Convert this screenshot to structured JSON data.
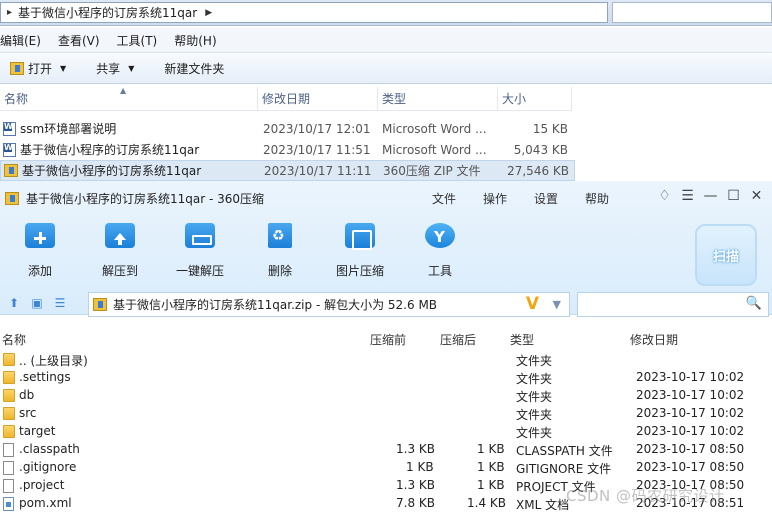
{
  "explorer": {
    "breadcrumb": "基于微信小程序的订房系统11qar",
    "menu": [
      "编辑(E)",
      "查看(V)",
      "工具(T)",
      "帮助(H)"
    ],
    "toolbar": {
      "open": "打开",
      "share": "共享",
      "new_folder": "新建文件夹"
    },
    "columns": {
      "name": "名称",
      "date": "修改日期",
      "type": "类型",
      "size": "大小"
    },
    "files": [
      {
        "name": "ssm环境部署说明",
        "date": "2023/10/17 12:01",
        "type": "Microsoft Word ...",
        "size": "15 KB",
        "icon": "word-doc-icon"
      },
      {
        "name": "基于微信小程序的订房系统11qar",
        "date": "2023/10/17 11:51",
        "type": "Microsoft Word ...",
        "size": "5,043 KB",
        "icon": "word-doc-icon"
      },
      {
        "name": "基于微信小程序的订房系统11qar",
        "date": "2023/10/17 11:11",
        "type": "360压缩 ZIP 文件",
        "size": "27,546 KB",
        "icon": "zip-icon"
      }
    ]
  },
  "zip": {
    "title": "基于微信小程序的订房系统11qar - 360压缩",
    "menu": [
      "文件",
      "操作",
      "设置",
      "帮助"
    ],
    "tools": [
      "添加",
      "解压到",
      "一键解压",
      "删除",
      "图片压缩",
      "工具"
    ],
    "scan_label": "扫描",
    "path": "基于微信小程序的订房系统11qar.zip - 解包大小为 52.6 MB",
    "columns": {
      "name": "名称",
      "compressed": "压缩前",
      "after": "压缩后",
      "type": "类型",
      "date": "修改日期"
    },
    "rows": [
      {
        "name": ".. (上级目录)",
        "before": "",
        "after": "",
        "type": "文件夹",
        "date": "",
        "icon": "folder-icon"
      },
      {
        "name": ".settings",
        "before": "",
        "after": "",
        "type": "文件夹",
        "date": "2023-10-17 10:02",
        "icon": "folder-icon"
      },
      {
        "name": "db",
        "before": "",
        "after": "",
        "type": "文件夹",
        "date": "2023-10-17 10:02",
        "icon": "folder-icon"
      },
      {
        "name": "src",
        "before": "",
        "after": "",
        "type": "文件夹",
        "date": "2023-10-17 10:02",
        "icon": "folder-icon"
      },
      {
        "name": "target",
        "before": "",
        "after": "",
        "type": "文件夹",
        "date": "2023-10-17 10:02",
        "icon": "folder-icon"
      },
      {
        "name": ".classpath",
        "before": "1.3 KB",
        "after": "1 KB",
        "type": "CLASSPATH 文件",
        "date": "2023-10-17 08:50",
        "icon": "file-icon"
      },
      {
        "name": ".gitignore",
        "before": "1 KB",
        "after": "1 KB",
        "type": "GITIGNORE 文件",
        "date": "2023-10-17 08:50",
        "icon": "file-icon"
      },
      {
        "name": ".project",
        "before": "1.3 KB",
        "after": "1 KB",
        "type": "PROJECT 文件",
        "date": "2023-10-17 08:50",
        "icon": "file-icon"
      },
      {
        "name": "pom.xml",
        "before": "7.8 KB",
        "after": "1.4 KB",
        "type": "XML 文档",
        "date": "2023-10-17 08:51",
        "icon": "xml-icon"
      }
    ]
  },
  "watermark": "CSDN @码农研究设计"
}
